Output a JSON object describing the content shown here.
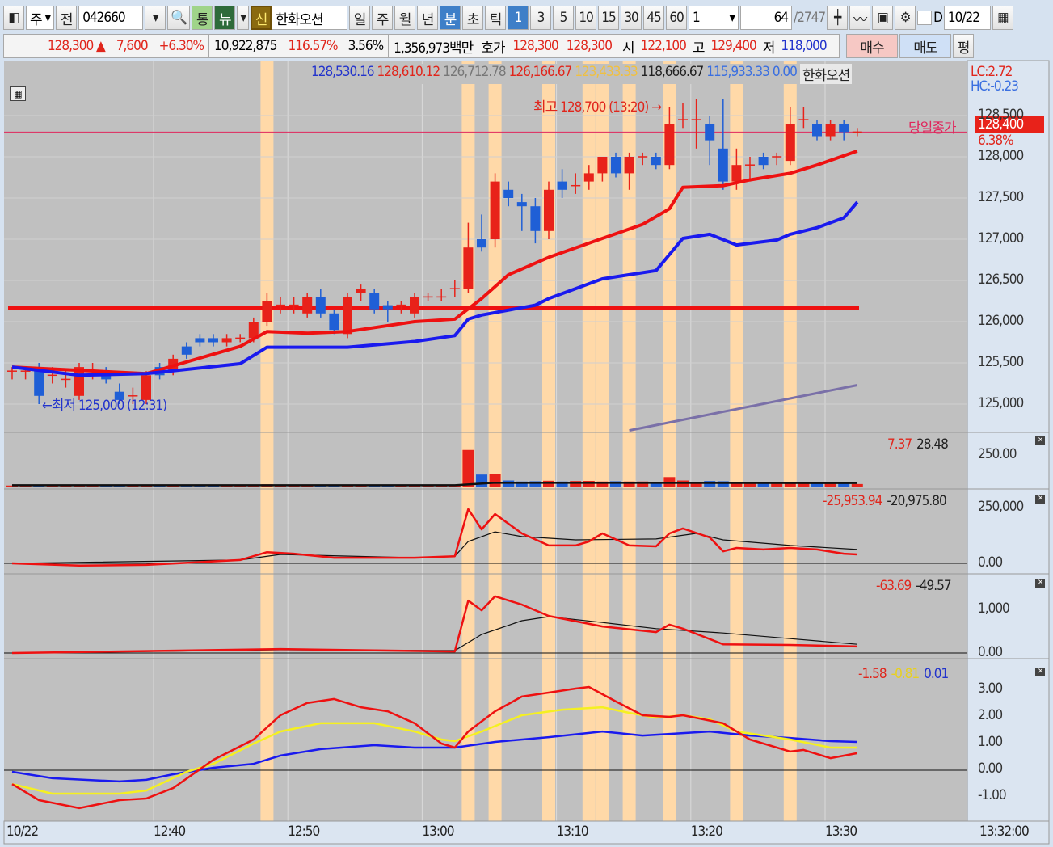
{
  "toolbar": {
    "market": "주",
    "prev": "전",
    "code": "042660",
    "tong": "통",
    "news": "뉴",
    "sin": "신",
    "name": "한화오션",
    "periods": [
      "일",
      "주",
      "월",
      "년",
      "분",
      "초",
      "틱"
    ],
    "selected_period": "분",
    "minutes": [
      "1",
      "3",
      "5",
      "10",
      "15",
      "30",
      "45",
      "60"
    ],
    "selected_minute": "1",
    "interval": "1",
    "count": "64",
    "total": "/2747",
    "d_label": "D",
    "date": "10/22"
  },
  "quote": {
    "price": "128,300",
    "arrow": "▲",
    "change": "7,600",
    "pct": "+6.30%",
    "volume": "10,922,875",
    "vol_ratio": "116.57%",
    "turnover": "3.56%",
    "amount": "1,356,973백만",
    "hoga_label": "호가",
    "ask": "128,300",
    "bid": "128,300",
    "open_label": "시",
    "open": "122,100",
    "high_label": "고",
    "high": "129,400",
    "low_label": "저",
    "low": "118,000",
    "buy": "매수",
    "sell": "매도",
    "avg": "평"
  },
  "legend": {
    "v1": "128,530.16",
    "v2": "128,610.12",
    "v3": "126,712.78",
    "v4": "126,166.67",
    "v5": "123,433.33",
    "v6": "118,666.67",
    "v7": "115,933.33",
    "v8": "0.00",
    "stock": "한화오션",
    "lc": "LC:2.72",
    "hc": "HC:-0.23"
  },
  "annotations": {
    "high": "최고 128,700 (13:20) →",
    "low": "←최저 125,000 (12:31)",
    "close_label": "당일종가",
    "close_value": "128,400",
    "close_pct": "6.38%"
  },
  "colors": {
    "up": "#e8221a",
    "down": "#1f5fd6",
    "highlight": "#ffd9a8",
    "bg": "#c0c0c0"
  },
  "chart_data": {
    "type": "candlestick",
    "x_ticks": [
      "12:40",
      "12:50",
      "13:00",
      "13:10",
      "13:20",
      "13:30"
    ],
    "date_label": "10/22",
    "last_time": "13:32:00",
    "price_ticks": [
      "128,500",
      "128,000",
      "127,500",
      "127,000",
      "126,500",
      "126,000",
      "125,500",
      "125,000"
    ],
    "first_bar": "12:29",
    "ohlc": [
      [
        125400,
        125450,
        125300,
        125400
      ],
      [
        125400,
        125450,
        125300,
        125400
      ],
      [
        125450,
        125500,
        125000,
        125100
      ],
      [
        125350,
        125450,
        125250,
        125350
      ],
      [
        125300,
        125400,
        125200,
        125300
      ],
      [
        125100,
        125500,
        125050,
        125450
      ],
      [
        125400,
        125500,
        125300,
        125400
      ],
      [
        125400,
        125450,
        125250,
        125300
      ],
      [
        125150,
        125250,
        125000,
        125050
      ],
      [
        125100,
        125200,
        125000,
        125100
      ],
      [
        125050,
        125400,
        125000,
        125350
      ],
      [
        125450,
        125500,
        125300,
        125350
      ],
      [
        125400,
        125600,
        125350,
        125550
      ],
      [
        125700,
        125750,
        125550,
        125600
      ],
      [
        125800,
        125850,
        125700,
        125750
      ],
      [
        125800,
        125850,
        125700,
        125750
      ],
      [
        125750,
        125850,
        125700,
        125800
      ],
      [
        125800,
        125850,
        125750,
        125800
      ],
      [
        125800,
        126050,
        125750,
        126000
      ],
      [
        126000,
        126350,
        125950,
        126250
      ],
      [
        126200,
        126300,
        126100,
        126200
      ],
      [
        126200,
        126300,
        126100,
        126200
      ],
      [
        126100,
        126350,
        126050,
        126300
      ],
      [
        126300,
        126400,
        126050,
        126100
      ],
      [
        126100,
        126150,
        125850,
        125900
      ],
      [
        125850,
        126350,
        125800,
        126300
      ],
      [
        126350,
        126450,
        126250,
        126400
      ],
      [
        126350,
        126400,
        126100,
        126150
      ],
      [
        126200,
        126250,
        126000,
        126150
      ],
      [
        126200,
        126250,
        126100,
        126200
      ],
      [
        126100,
        126350,
        126050,
        126300
      ],
      [
        126300,
        126350,
        126250,
        126300
      ],
      [
        126300,
        126400,
        126250,
        126300
      ],
      [
        126400,
        126500,
        126300,
        126400
      ],
      [
        126400,
        127200,
        126350,
        126900
      ],
      [
        127000,
        127300,
        126850,
        126900
      ],
      [
        127000,
        127800,
        126900,
        127700
      ],
      [
        127600,
        127700,
        127400,
        127500
      ],
      [
        127450,
        127550,
        127100,
        127400
      ],
      [
        127400,
        127500,
        126950,
        127100
      ],
      [
        127100,
        127700,
        127000,
        127600
      ],
      [
        127700,
        127850,
        127500,
        127600
      ],
      [
        127650,
        127800,
        127550,
        127650
      ],
      [
        127700,
        127900,
        127600,
        127800
      ],
      [
        127800,
        128000,
        127700,
        128000
      ],
      [
        128000,
        128050,
        127750,
        127800
      ],
      [
        127800,
        128050,
        127600,
        128000
      ],
      [
        128000,
        128050,
        127900,
        128000
      ],
      [
        128000,
        128050,
        127850,
        127900
      ],
      [
        127900,
        128600,
        127850,
        128400
      ],
      [
        128450,
        128650,
        128350,
        128450
      ],
      [
        128450,
        128700,
        128100,
        128450
      ],
      [
        128400,
        128500,
        127900,
        128200
      ],
      [
        128100,
        128700,
        127600,
        127700
      ],
      [
        127700,
        128100,
        127600,
        127900
      ],
      [
        127900,
        128000,
        127700,
        127900
      ],
      [
        128000,
        128050,
        127850,
        127900
      ],
      [
        128000,
        128050,
        127900,
        128000
      ],
      [
        127950,
        128600,
        127900,
        128400
      ],
      [
        128450,
        128600,
        128350,
        128450
      ],
      [
        128400,
        128450,
        128200,
        128250
      ],
      [
        128250,
        128450,
        128200,
        128400
      ],
      [
        128400,
        128450,
        128200,
        128300
      ],
      [
        128300,
        128350,
        128250,
        128300
      ]
    ],
    "highlight_bars": [
      19,
      34,
      36,
      40,
      43,
      44,
      46,
      49,
      54,
      58
    ],
    "ma_red": [
      [
        0,
        125450
      ],
      [
        10,
        125370
      ],
      [
        17,
        125700
      ],
      [
        19,
        125880
      ],
      [
        22,
        125860
      ],
      [
        25,
        125880
      ],
      [
        30,
        126000
      ],
      [
        33,
        126030
      ],
      [
        35,
        126280
      ],
      [
        37,
        126570
      ],
      [
        40,
        126780
      ],
      [
        44,
        127010
      ],
      [
        47,
        127180
      ],
      [
        49,
        127370
      ],
      [
        50,
        127630
      ],
      [
        53,
        127650
      ],
      [
        55,
        127720
      ],
      [
        58,
        127800
      ],
      [
        60,
        127900
      ],
      [
        63,
        128070
      ]
    ],
    "ma_blue": [
      [
        0,
        125450
      ],
      [
        5,
        125350
      ],
      [
        10,
        125370
      ],
      [
        17,
        125490
      ],
      [
        19,
        125690
      ],
      [
        25,
        125690
      ],
      [
        30,
        125760
      ],
      [
        33,
        125830
      ],
      [
        34,
        126030
      ],
      [
        35,
        126080
      ],
      [
        39,
        126200
      ],
      [
        40,
        126280
      ],
      [
        44,
        126520
      ],
      [
        48,
        126620
      ],
      [
        50,
        127010
      ],
      [
        52,
        127060
      ],
      [
        54,
        126930
      ],
      [
        57,
        126990
      ],
      [
        58,
        127060
      ],
      [
        60,
        127140
      ],
      [
        62,
        127260
      ],
      [
        63,
        127450
      ]
    ],
    "hline": 126166.67,
    "close_line": 128300,
    "trend": [
      [
        46,
        124680
      ],
      [
        63,
        125230
      ]
    ],
    "volume": {
      "legend": [
        "7.37",
        "28.48"
      ],
      "ticks": [
        "250.00"
      ],
      "values": [
        8,
        6,
        12,
        5,
        6,
        10,
        5,
        6,
        9,
        5,
        10,
        6,
        8,
        7,
        5,
        6,
        6,
        5,
        9,
        18,
        6,
        5,
        8,
        10,
        9,
        14,
        7,
        9,
        8,
        5,
        10,
        5,
        6,
        12,
        290,
        95,
        100,
        48,
        40,
        42,
        46,
        40,
        44,
        45,
        40,
        42,
        40,
        40,
        36,
        75,
        48,
        38,
        44,
        42,
        32,
        26,
        24,
        22,
        38,
        24,
        26,
        22,
        24,
        20
      ],
      "ma": [
        [
          0,
          10
        ],
        [
          33,
          10
        ],
        [
          36,
          30
        ],
        [
          63,
          28
        ]
      ]
    },
    "ind1": {
      "legend": [
        "-25,953.94",
        "-20,975.80"
      ],
      "ticks": [
        "250,000",
        "0.00"
      ],
      "red": [
        [
          0,
          0
        ],
        [
          5,
          -10000
        ],
        [
          10,
          -7000
        ],
        [
          17,
          15000
        ],
        [
          19,
          50000
        ],
        [
          21,
          43000
        ],
        [
          24,
          25000
        ],
        [
          30,
          25000
        ],
        [
          33,
          32000
        ],
        [
          34,
          243000
        ],
        [
          35,
          152000
        ],
        [
          36,
          221000
        ],
        [
          38,
          134000
        ],
        [
          40,
          80000
        ],
        [
          42,
          80000
        ],
        [
          43,
          98000
        ],
        [
          44,
          134000
        ],
        [
          46,
          80000
        ],
        [
          48,
          76000
        ],
        [
          49,
          134000
        ],
        [
          50,
          156000
        ],
        [
          52,
          116000
        ],
        [
          53,
          54000
        ],
        [
          54,
          69000
        ],
        [
          56,
          62000
        ],
        [
          58,
          69000
        ],
        [
          60,
          62000
        ],
        [
          62,
          43000
        ],
        [
          63,
          40000
        ]
      ],
      "black": [
        [
          0,
          0
        ],
        [
          17,
          15000
        ],
        [
          20,
          40000
        ],
        [
          30,
          25000
        ],
        [
          33,
          32000
        ],
        [
          34,
          98000
        ],
        [
          36,
          141000
        ],
        [
          38,
          120000
        ],
        [
          42,
          105000
        ],
        [
          48,
          109000
        ],
        [
          51,
          134000
        ],
        [
          53,
          105000
        ],
        [
          58,
          80000
        ],
        [
          63,
          62000
        ]
      ]
    },
    "ind2": {
      "legend": [
        "-63.69",
        "-49.57"
      ],
      "ticks": [
        "1,000",
        "0.00"
      ],
      "red": [
        [
          0,
          0
        ],
        [
          20,
          90
        ],
        [
          33,
          35
        ],
        [
          34,
          1200
        ],
        [
          35,
          980
        ],
        [
          36,
          1300
        ],
        [
          38,
          1110
        ],
        [
          40,
          850
        ],
        [
          44,
          610
        ],
        [
          48,
          480
        ],
        [
          49,
          650
        ],
        [
          50,
          560
        ],
        [
          53,
          200
        ],
        [
          58,
          185
        ],
        [
          63,
          150
        ]
      ],
      "black": [
        [
          0,
          0
        ],
        [
          20,
          75
        ],
        [
          33,
          55
        ],
        [
          35,
          425
        ],
        [
          38,
          740
        ],
        [
          40,
          833
        ],
        [
          44,
          700
        ],
        [
          48,
          560
        ],
        [
          53,
          460
        ],
        [
          58,
          330
        ],
        [
          63,
          200
        ]
      ]
    },
    "ind3": {
      "legend": [
        "-1.58",
        "-0.81",
        "0.01"
      ],
      "ticks": [
        "3.00",
        "2.00",
        "1.00",
        "0.00",
        "-1.00"
      ],
      "red": [
        [
          0,
          -0.52
        ],
        [
          2,
          -1.12
        ],
        [
          5,
          -1.42
        ],
        [
          8,
          -1.12
        ],
        [
          10,
          -1.06
        ],
        [
          12,
          -0.67
        ],
        [
          15,
          0.39
        ],
        [
          18,
          1.15
        ],
        [
          20,
          2.06
        ],
        [
          22,
          2.52
        ],
        [
          24,
          2.67
        ],
        [
          26,
          2.36
        ],
        [
          28,
          2.21
        ],
        [
          30,
          1.76
        ],
        [
          32,
          1.0
        ],
        [
          33,
          0.85
        ],
        [
          34,
          1.45
        ],
        [
          36,
          2.21
        ],
        [
          38,
          2.76
        ],
        [
          40,
          2.91
        ],
        [
          42,
          3.06
        ],
        [
          43,
          3.12
        ],
        [
          45,
          2.58
        ],
        [
          47,
          2.06
        ],
        [
          49,
          2.0
        ],
        [
          50,
          2.06
        ],
        [
          53,
          1.76
        ],
        [
          55,
          1.15
        ],
        [
          58,
          0.7
        ],
        [
          59,
          0.76
        ],
        [
          61,
          0.45
        ],
        [
          63,
          0.64
        ]
      ],
      "yellow": [
        [
          0,
          -0.52
        ],
        [
          3,
          -0.88
        ],
        [
          8,
          -0.88
        ],
        [
          10,
          -0.76
        ],
        [
          13,
          -0.06
        ],
        [
          15,
          0.24
        ],
        [
          18,
          1.0
        ],
        [
          20,
          1.45
        ],
        [
          23,
          1.76
        ],
        [
          27,
          1.76
        ],
        [
          30,
          1.45
        ],
        [
          32,
          1.15
        ],
        [
          33,
          1.09
        ],
        [
          35,
          1.45
        ],
        [
          38,
          2.06
        ],
        [
          41,
          2.27
        ],
        [
          44,
          2.36
        ],
        [
          46,
          2.15
        ],
        [
          48,
          1.97
        ],
        [
          50,
          2.06
        ],
        [
          52,
          1.91
        ],
        [
          54,
          1.45
        ],
        [
          58,
          1.15
        ],
        [
          61,
          0.85
        ],
        [
          63,
          0.85
        ]
      ],
      "blue": [
        [
          0,
          -0.06
        ],
        [
          3,
          -0.3
        ],
        [
          8,
          -0.42
        ],
        [
          10,
          -0.36
        ],
        [
          12,
          -0.15
        ],
        [
          15,
          0.09
        ],
        [
          18,
          0.24
        ],
        [
          20,
          0.55
        ],
        [
          23,
          0.79
        ],
        [
          27,
          0.94
        ],
        [
          30,
          0.85
        ],
        [
          33,
          0.85
        ],
        [
          36,
          1.06
        ],
        [
          40,
          1.24
        ],
        [
          44,
          1.45
        ],
        [
          47,
          1.3
        ],
        [
          50,
          1.39
        ],
        [
          52,
          1.45
        ],
        [
          55,
          1.3
        ],
        [
          58,
          1.21
        ],
        [
          61,
          1.09
        ],
        [
          63,
          1.06
        ]
      ]
    }
  }
}
